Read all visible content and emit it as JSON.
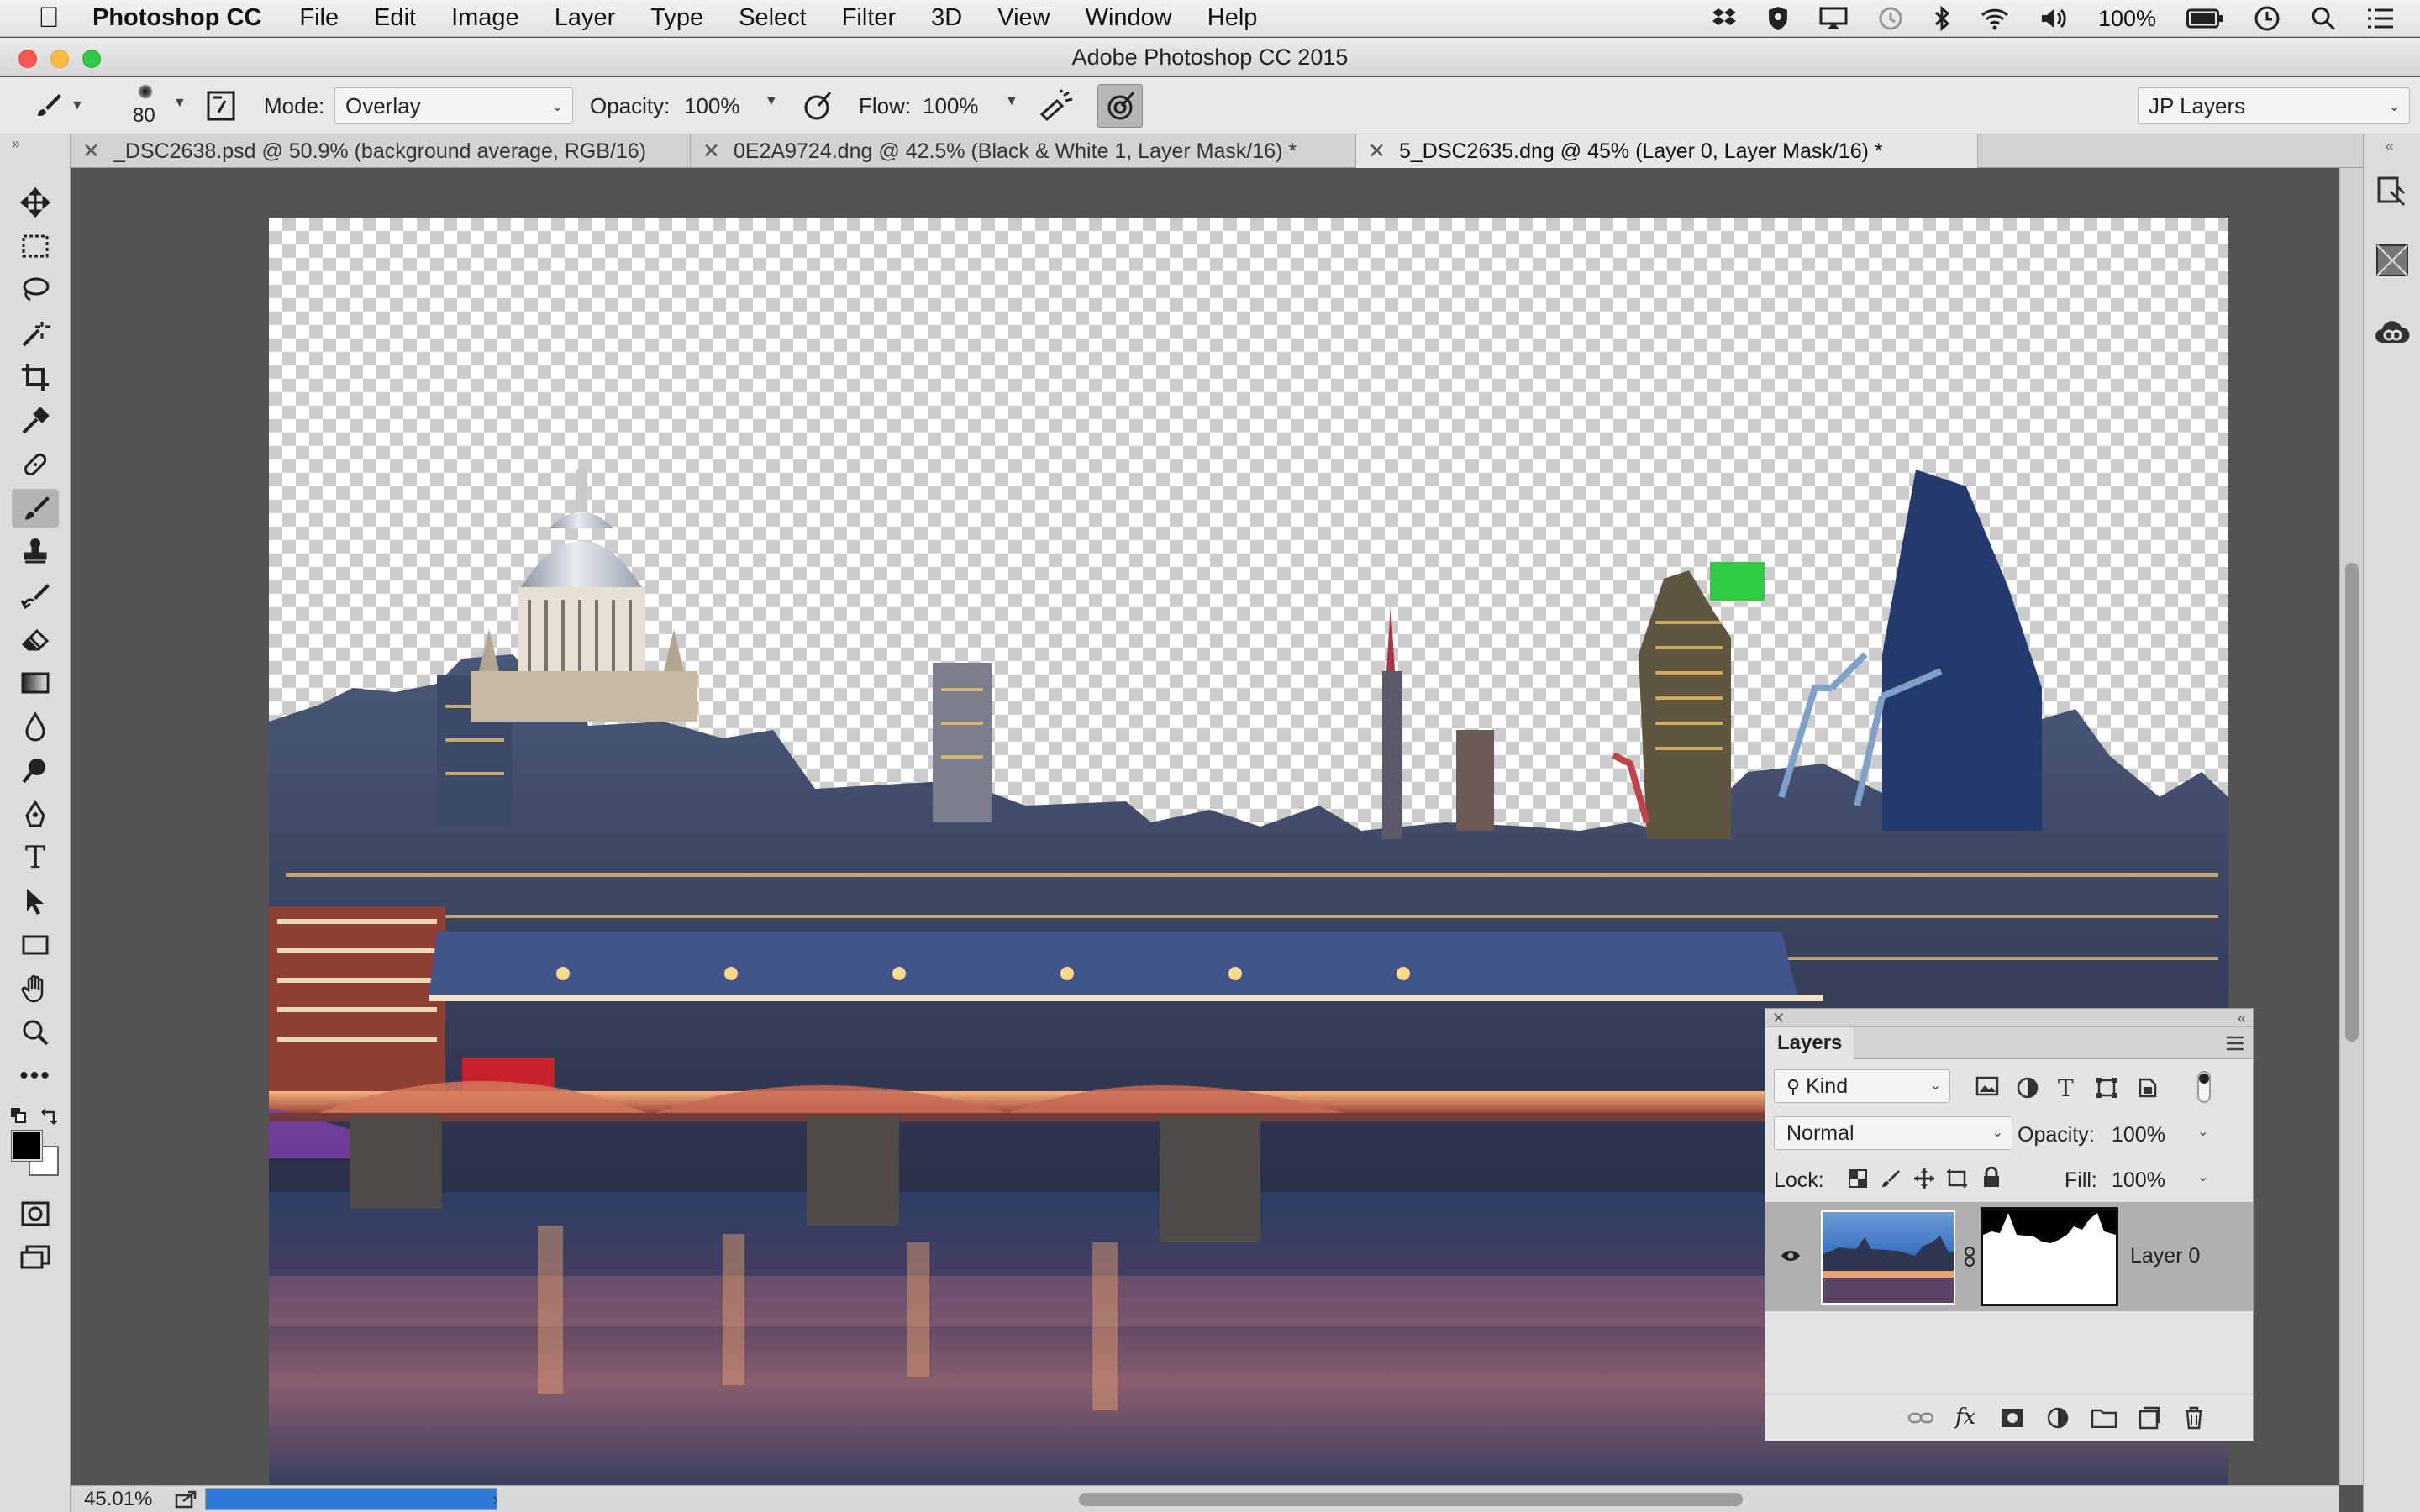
{
  "menubar": {
    "app_name": "Photoshop CC",
    "items": [
      "File",
      "Edit",
      "Image",
      "Layer",
      "Type",
      "Select",
      "Filter",
      "3D",
      "View",
      "Window",
      "Help"
    ],
    "battery": "100%"
  },
  "window": {
    "title": "Adobe Photoshop CC 2015"
  },
  "options": {
    "brush_size": "80",
    "mode_label": "Mode:",
    "mode_value": "Overlay",
    "opacity_label": "Opacity:",
    "opacity_value": "100%",
    "flow_label": "Flow:",
    "flow_value": "100%",
    "workspace": "JP Layers"
  },
  "tabs": [
    {
      "label": "_DSC2638.psd @ 50.9% (background average, RGB/16)"
    },
    {
      "label": "0E2A9724.dng @ 42.5% (Black & White 1, Layer Mask/16) *"
    },
    {
      "label": "5_DSC2635.dng @ 45% (Layer 0, Layer Mask/16) *"
    }
  ],
  "status": {
    "zoom": "45.01%",
    "progress": 1.0
  },
  "layers_panel": {
    "title": "Layers",
    "filter_kind": "Kind",
    "blend_mode": "Normal",
    "opacity_label": "Opacity:",
    "opacity_value": "100%",
    "lock_label": "Lock:",
    "fill_label": "Fill:",
    "fill_value": "100%",
    "layer_name": "Layer 0",
    "fx_label": "fx"
  },
  "text_tool_glyph": "T",
  "colors": {
    "accent": "#2f7ad8",
    "foreground": "#000000",
    "background": "#ffffff"
  }
}
